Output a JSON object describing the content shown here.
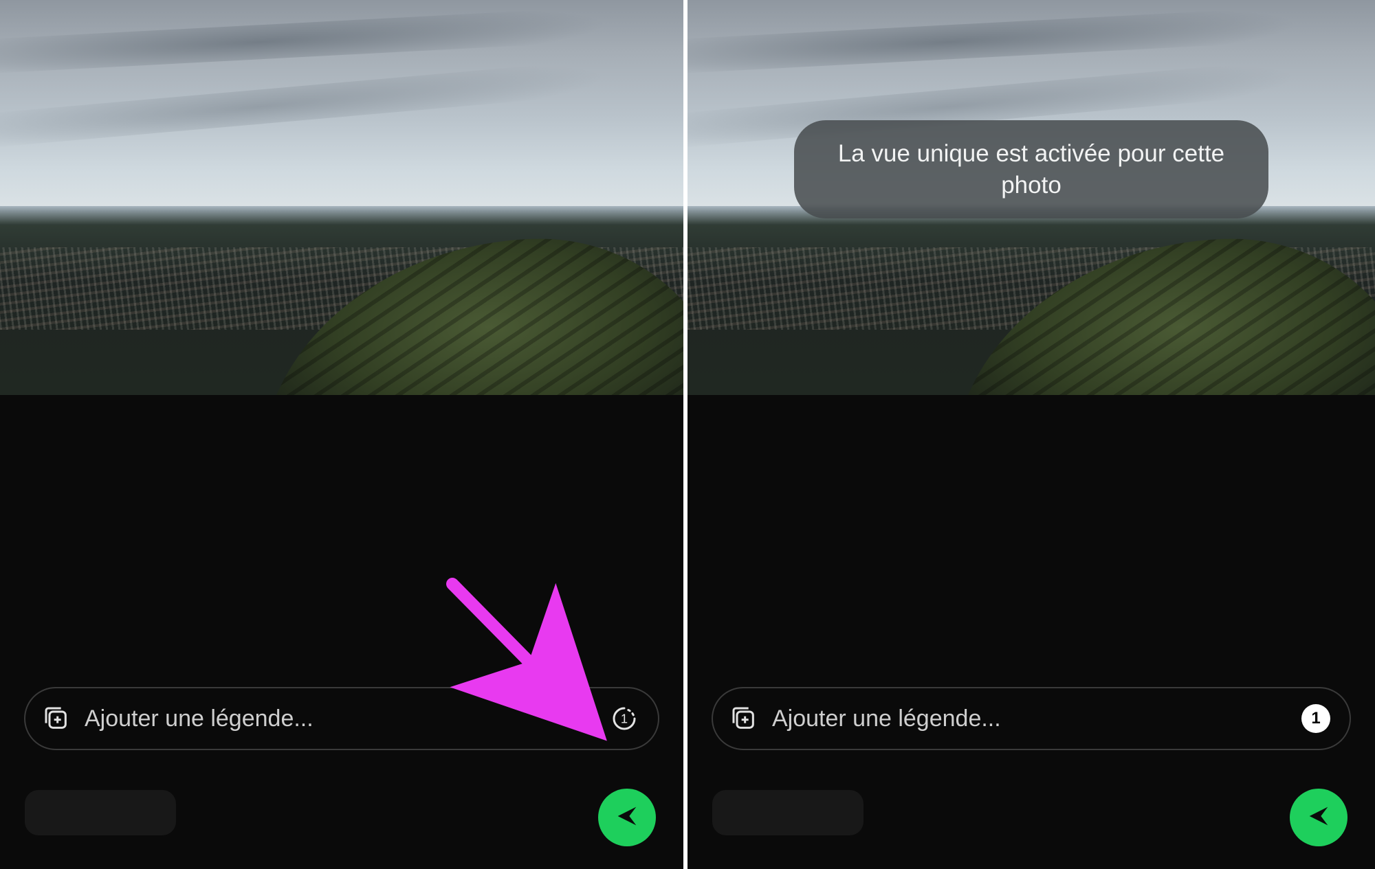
{
  "colors": {
    "accent_send": "#1ecf5c",
    "annotation_arrow": "#e83af0"
  },
  "left": {
    "caption_placeholder": "Ajouter une légende...",
    "view_once_value": "1",
    "arrow_visible": true
  },
  "right": {
    "toast_text": "La vue unique est activée pour cette photo",
    "caption_placeholder": "Ajouter une légende...",
    "view_once_value": "1"
  },
  "icons": {
    "add_media": "add-media-icon",
    "view_once": "view-once-icon",
    "send": "send-icon"
  }
}
